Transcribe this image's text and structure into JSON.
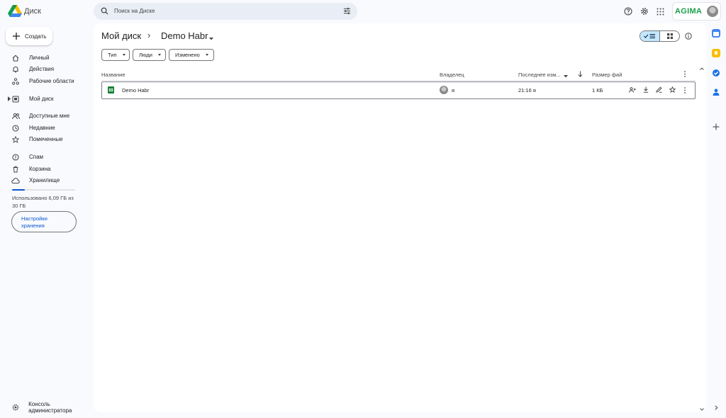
{
  "app": {
    "name": "Диск"
  },
  "search": {
    "placeholder": "Поиск на Диске"
  },
  "brand": {
    "badge": "AGIMA"
  },
  "sidebar": {
    "create_label": "Создать",
    "items": [
      {
        "label": "Личный",
        "icon": "home-icon"
      },
      {
        "label": "Действия",
        "icon": "bell-icon"
      },
      {
        "label": "Рабочие области",
        "icon": "workspaces-icon"
      },
      {
        "label": "Мой диск",
        "icon": "drive-icon"
      },
      {
        "label": "Доступные мне",
        "icon": "shared-icon"
      },
      {
        "label": "Недавние",
        "icon": "clock-icon"
      },
      {
        "label": "Помеченные",
        "icon": "star-icon"
      },
      {
        "label": "Спам",
        "icon": "spam-icon"
      },
      {
        "label": "Корзина",
        "icon": "trash-icon"
      },
      {
        "label": "Хранилище",
        "icon": "cloud-icon"
      }
    ],
    "storage_text": "Использовано 6,09 ГБ из 30 ГБ",
    "storage_fraction": 0.203,
    "storage_button": "Настройки хранения",
    "admin_console": "Консоль администратора"
  },
  "breadcrumb": {
    "root": "Мой диск",
    "separator": "›",
    "current": "Demo Habr"
  },
  "filters": [
    {
      "label": "Тип"
    },
    {
      "label": "Люди"
    },
    {
      "label": "Изменено"
    }
  ],
  "table": {
    "columns": {
      "name": "Название",
      "owner": "Владелец",
      "modified": "Последнее изм...",
      "size": "Размер фай"
    },
    "rows": [
      {
        "name": "Demo Habr",
        "owner": "я",
        "modified": "21:16 я",
        "size": "1 КБ"
      }
    ]
  },
  "colors": {
    "accent": "#0b57d0",
    "sheets_green": "#188038",
    "brand_green": "#1b9e4b",
    "view_toggle_active": "#c2e7ff"
  }
}
